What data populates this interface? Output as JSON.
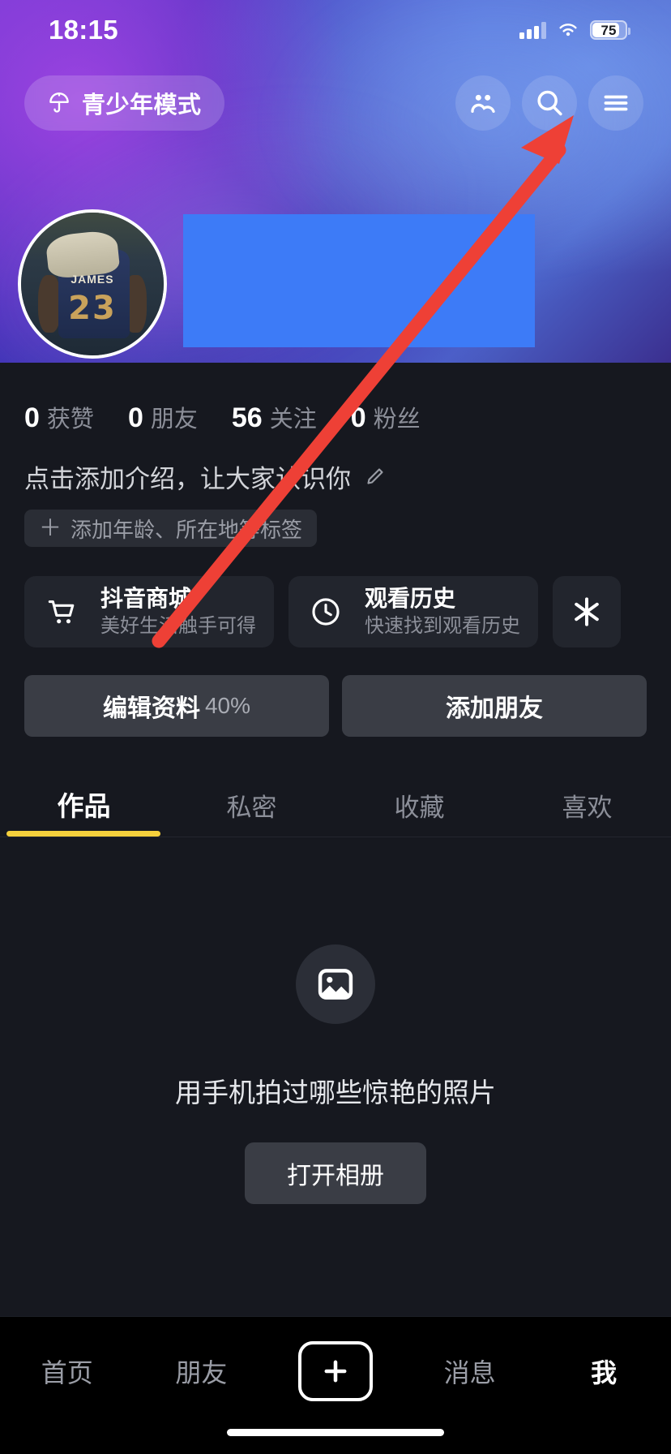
{
  "status_bar": {
    "time": "18:15",
    "battery_level": "75",
    "signal_icon": "cellular-signal-icon",
    "wifi_icon": "wifi-icon",
    "battery_icon": "battery-icon"
  },
  "top_nav": {
    "teen_mode_label": "青少年模式",
    "teen_mode_icon": "umbrella-icon",
    "friends_icon": "friends-icon",
    "search_icon": "search-icon",
    "menu_icon": "hamburger-menu-icon"
  },
  "profile": {
    "avatar_alt": "JAMES",
    "avatar_jersey_name": "JAMES",
    "avatar_jersey_number": "23",
    "redaction_color": "#3d7bf7",
    "stats": [
      {
        "num": "0",
        "label": "获赞"
      },
      {
        "num": "0",
        "label": "朋友"
      },
      {
        "num": "56",
        "label": "关注"
      },
      {
        "num": "0",
        "label": "粉丝"
      }
    ],
    "bio_placeholder": "点击添加介绍，让大家认识你",
    "bio_edit_icon": "pencil-icon",
    "tag_plus": "＋",
    "tag_label": "添加年龄、所在地等标签"
  },
  "shortcut_cards": [
    {
      "title": "抖音商城",
      "subtitle": "美好生活触手可得",
      "icon": "shopping-cart-icon"
    },
    {
      "title": "观看历史",
      "subtitle": "快速找到观看历史",
      "icon": "clock-icon"
    },
    {
      "title": "",
      "subtitle": "",
      "icon": "sparkle-icon"
    }
  ],
  "actions": {
    "edit_profile_label": "编辑资料",
    "edit_profile_percent": "40%",
    "add_friend_label": "添加朋友"
  },
  "content_tabs": {
    "items": [
      {
        "label": "作品",
        "active": true
      },
      {
        "label": "私密",
        "active": false
      },
      {
        "label": "收藏",
        "active": false
      },
      {
        "label": "喜欢",
        "active": false
      }
    ],
    "active_underline_color": "#f5d03c"
  },
  "empty_state": {
    "icon": "image-placeholder-icon",
    "message": "用手机拍过哪些惊艳的照片",
    "button_label": "打开相册"
  },
  "bottom_nav": {
    "items": [
      {
        "label": "首页",
        "active": false
      },
      {
        "label": "朋友",
        "active": false
      },
      {
        "label": "",
        "active": false,
        "icon": "plus-icon"
      },
      {
        "label": "消息",
        "active": false
      },
      {
        "label": "我",
        "active": true
      }
    ]
  },
  "annotation": {
    "arrow_color": "#ee4036",
    "arrow_target": "hamburger-menu-icon"
  }
}
